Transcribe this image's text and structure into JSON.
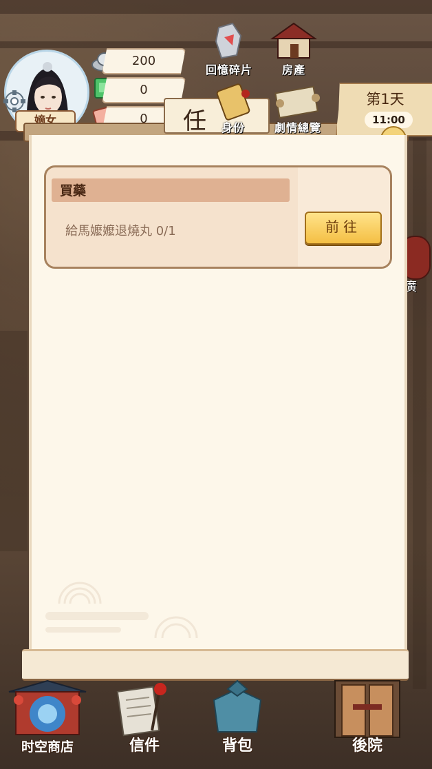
{
  "resources": {
    "silver": "200",
    "jade": "0",
    "ticket": "0"
  },
  "player": {
    "rank": "嫡女"
  },
  "top_menu": {
    "memory_fragments": "回憶碎片",
    "property": "房產",
    "identity": "身份",
    "story_overview": "劇情總覽"
  },
  "day": {
    "title": "第1天",
    "time": "11:00"
  },
  "panel": {
    "title_char": "任"
  },
  "tasks": [
    {
      "name": "買藥",
      "desc": "給馬嬤嬤退燒丸 0/1",
      "button": "前往"
    }
  ],
  "side": {
    "right_label": "廣"
  },
  "bottom_nav": {
    "shop": "时空商店",
    "letters": "信件",
    "bag": "背包",
    "backyard": "後院"
  }
}
